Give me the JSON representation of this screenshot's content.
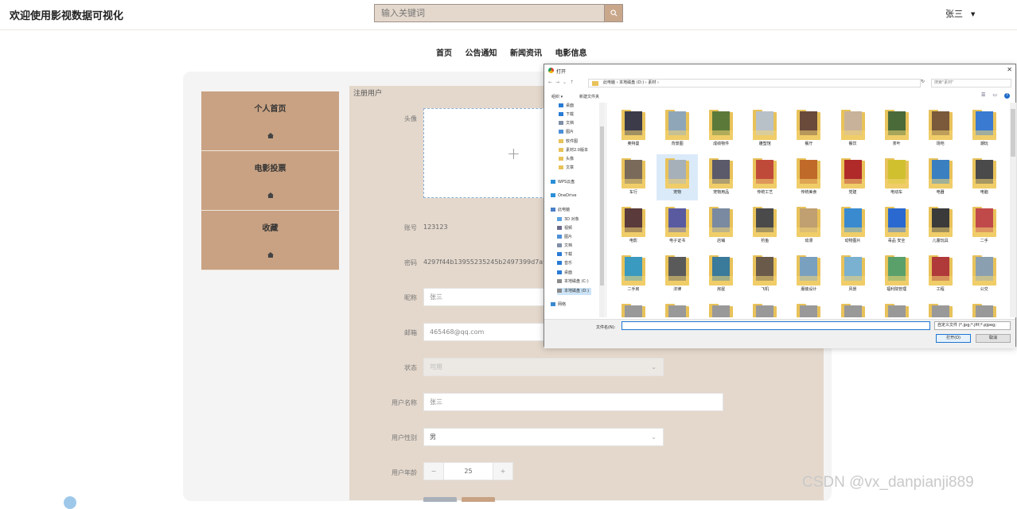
{
  "header": {
    "site_title": "欢迎使用影视数据可视化",
    "search_placeholder": "输入关键词",
    "user_name": "张三"
  },
  "nav": [
    "首页",
    "公告通知",
    "新闻资讯",
    "电影信息"
  ],
  "sidebar": [
    {
      "label": "个人首页"
    },
    {
      "label": "电影投票"
    },
    {
      "label": "收藏"
    }
  ],
  "form": {
    "title": "注册用户",
    "avatar_label": "头像",
    "account_label": "账号",
    "account_value": "123123",
    "password_label": "密码",
    "password_value": "4297f44b13955235245b2497399d7a93",
    "nickname_label": "昵称",
    "nickname_value": "张三",
    "email_label": "邮箱",
    "email_value": "465468@qq.com",
    "status_label": "状态",
    "status_value": "可用",
    "username_label": "用户名称",
    "username_value": "张三",
    "gender_label": "用户性别",
    "gender_value": "男",
    "age_label": "用户年龄",
    "age_value": "25"
  },
  "dialog": {
    "title": "打开",
    "path": "此电脑 › 本地磁盘 (D:) › 素材 ›",
    "search_placeholder": "搜索\"素材\"",
    "organize": "组织 ▾",
    "new_folder": "新建文件夹",
    "tree": [
      {
        "label": "桌面",
        "icon": "desktop-icon"
      },
      {
        "label": "下载",
        "icon": "download-icon"
      },
      {
        "label": "文档",
        "icon": "document-icon"
      },
      {
        "label": "图片",
        "icon": "picture-icon"
      },
      {
        "label": "软件图",
        "icon": "folder-icon"
      },
      {
        "label": "素材2.0版本",
        "icon": "folder-icon"
      },
      {
        "label": "头像",
        "icon": "folder-icon"
      },
      {
        "label": "文章",
        "icon": "folder-icon"
      },
      {
        "label": "WPS云盘",
        "icon": "cloud-icon"
      },
      {
        "label": "OneDrive",
        "icon": "cloud-icon"
      },
      {
        "label": "此电脑",
        "icon": "computer-icon"
      },
      {
        "label": "3D 对象",
        "icon": "cube-icon"
      },
      {
        "label": "视频",
        "icon": "video-icon"
      },
      {
        "label": "图片",
        "icon": "picture-icon"
      },
      {
        "label": "文档",
        "icon": "document-icon"
      },
      {
        "label": "下载",
        "icon": "download-icon"
      },
      {
        "label": "音乐",
        "icon": "music-icon"
      },
      {
        "label": "桌面",
        "icon": "desktop-icon"
      },
      {
        "label": "本地磁盘 (C:)",
        "icon": "drive-icon"
      },
      {
        "label": "本地磁盘 (D:)",
        "icon": "drive-icon"
      },
      {
        "label": "网络",
        "icon": "network-icon"
      }
    ],
    "files": [
      "奥特曼",
      "背景图",
      "成绩物件",
      "雕塑馆",
      "餐厅",
      "餐饮",
      "茶叶",
      "场地",
      "潮玩",
      "车行",
      "宠物",
      "宠物用品",
      "传统工艺",
      "传统美食",
      "党建",
      "电动车",
      "电器",
      "电脑",
      "电影",
      "电子证书",
      "店铺",
      "钓鱼",
      "动漫",
      "动物图片",
      "毒品 安全",
      "儿童玩具",
      "二手",
      "二手房",
      "法律",
      "房屋",
      "飞机",
      "服装设计",
      "风景",
      "福利院管理",
      "工程",
      "公交",
      "",
      "",
      "",
      "",
      "",
      "",
      "",
      "",
      ""
    ],
    "filename_label": "文件名(N):",
    "filetype_value": "自定义文件 (*.jpg;*.jfif;*.pjpeg;",
    "open_button": "打开(O)",
    "cancel_button": "取消"
  },
  "watermark": "CSDN @vx_danpianji889"
}
